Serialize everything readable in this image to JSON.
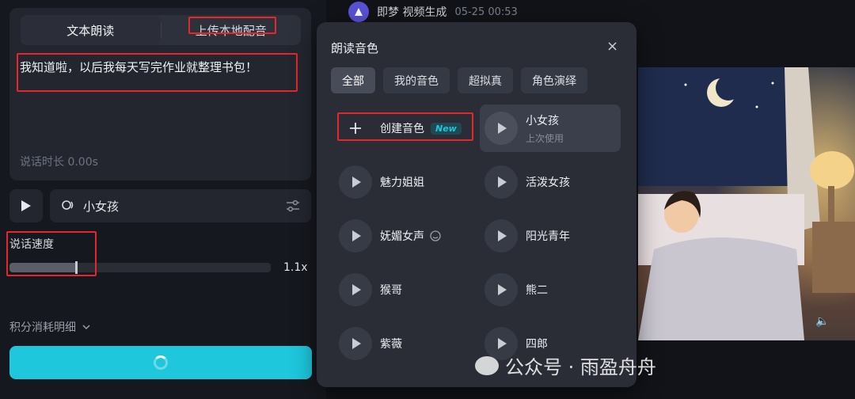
{
  "tts": {
    "tab_read": "文本朗读",
    "tab_upload": "上传本地配音",
    "text": "我知道啦，以后我每天写完作业就整理书包！",
    "duration": "说话时长 0.00s"
  },
  "voice_select": {
    "name": "小女孩"
  },
  "speed": {
    "label": "说话速度",
    "value": "1.1x",
    "level": 0.25
  },
  "credits": {
    "label": "积分消耗明细"
  },
  "header": {
    "title": "即梦 视频生成",
    "time": "05-25 00:53"
  },
  "modal": {
    "title": "朗读音色",
    "close": "×",
    "filters": [
      "全部",
      "我的音色",
      "超拟真",
      "角色演绎"
    ],
    "create_label": "创建音色",
    "new_badge": "New",
    "voices": [
      {
        "name": "小女孩",
        "sub": "上次使用"
      },
      {
        "name": "魅力姐姐"
      },
      {
        "name": "活泼女孩"
      },
      {
        "name": "妩媚女声"
      },
      {
        "name": "阳光青年"
      },
      {
        "name": "猴哥"
      },
      {
        "name": "熊二"
      },
      {
        "name": "紫薇"
      },
      {
        "name": "四郎"
      }
    ]
  },
  "watermark": {
    "text": "公众号 · 雨盈舟舟"
  },
  "colors": {
    "accent": "#1ec7dc",
    "annotation": "#e5262b"
  }
}
